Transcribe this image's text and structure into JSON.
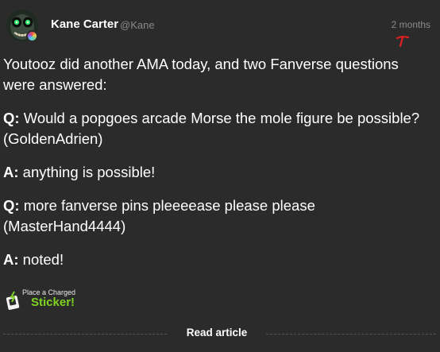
{
  "post": {
    "author_name": "Kane Carter",
    "author_handle": "@Kane",
    "timestamp": "2 months",
    "paragraphs": [
      {
        "prefix": "",
        "text": "Youtooz did another AMA today, and two Fanverse questions were answered:"
      },
      {
        "prefix": "Q:",
        "text": " Would a popgoes arcade Morse the mole figure be possible? (GoldenAdrien)"
      },
      {
        "prefix": "A:",
        "text": " anything is possible!"
      },
      {
        "prefix": "Q:",
        "text": " more fanverse pins pleeeease please please (MasterHand4444)"
      },
      {
        "prefix": "A:",
        "text": " noted!"
      }
    ]
  },
  "sticker": {
    "line1": "Place a Charged",
    "line2": "Sticker!",
    "accent_color": "#7ed321"
  },
  "footer": {
    "read_article_label": "Read article"
  },
  "colors": {
    "background": "#2b2b2b",
    "muted_text": "#8a8a8a",
    "annotation_red": "#e02020"
  },
  "icons": {
    "avatar": "avatar-image",
    "badge": "color-wheel-badge-icon",
    "sticker": "sticker-icon",
    "annotation": "red-arrow-mark-icon"
  }
}
